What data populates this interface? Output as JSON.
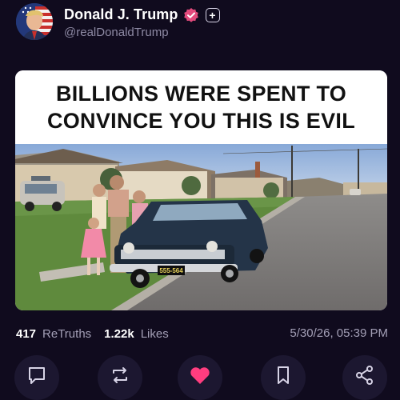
{
  "post": {
    "author_name": "Donald J. Trump",
    "author_handle": "@realDonaldTrump",
    "meme_caption": "BILLIONS WERE SPENT TO CONVINCE YOU THIS IS EVIL",
    "license_plate": "555-564"
  },
  "stats": {
    "retruths_count": "417",
    "retruths_label": "ReTruths",
    "likes_count": "1.22k",
    "likes_label": "Likes",
    "timestamp": "5/30/26, 05:39 PM"
  },
  "icons": {
    "verified": "verified-badge-icon",
    "follow": "plus-icon",
    "reply": "comment-icon",
    "retruth": "repost-icon",
    "like": "heart-icon",
    "bookmark": "bookmark-icon",
    "share": "share-icon"
  },
  "colors": {
    "background": "#100b1e",
    "verified": "#e24a7c",
    "like_active": "#ff3d7f",
    "muted_text": "#a39fb6"
  }
}
